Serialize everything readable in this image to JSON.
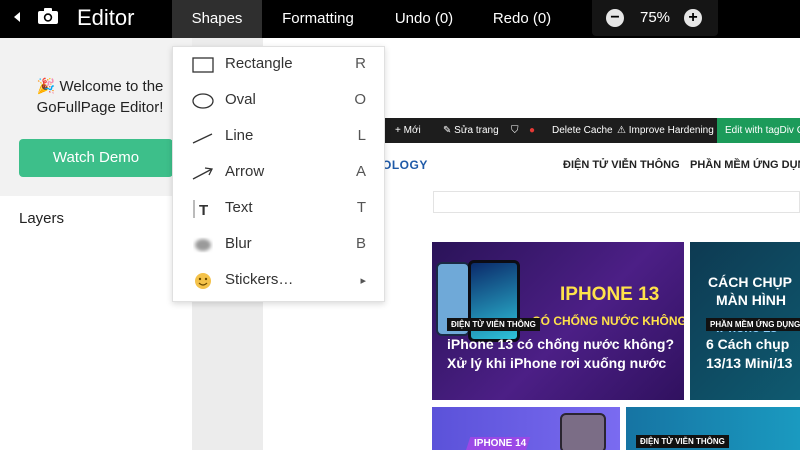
{
  "app": {
    "title": "Editor",
    "back_icon": "chevron-left-icon",
    "camera_icon": "camera-icon"
  },
  "menus": {
    "shapes": "Shapes",
    "formatting": "Formatting",
    "undo": "Undo (0)",
    "redo": "Redo (0)"
  },
  "zoom": {
    "minus": "−",
    "value": "75%",
    "plus": "+"
  },
  "left_panel": {
    "welcome_emoji": "🎉",
    "welcome_text": "Welcome to the GoFullPage Editor!",
    "watch_demo": "Watch Demo",
    "layers": "Layers",
    "accent_color": "#3dbf8a"
  },
  "shapes_menu": {
    "items": [
      {
        "label": "Rectangle",
        "key": "R",
        "icon": "rectangle-icon"
      },
      {
        "label": "Oval",
        "key": "O",
        "icon": "oval-icon"
      },
      {
        "label": "Line",
        "key": "L",
        "icon": "line-icon"
      },
      {
        "label": "Arrow",
        "key": "A",
        "icon": "arrow-icon"
      },
      {
        "label": "Text",
        "key": "T",
        "icon": "text-icon"
      },
      {
        "label": "Blur",
        "key": "B",
        "icon": "blur-icon"
      },
      {
        "label": "Stickers…",
        "key": "▸",
        "icon": "smiley-icon"
      }
    ]
  },
  "webpage": {
    "admin_bar": {
      "new": "+ Mới",
      "edit": "✎ Sửa trang",
      "delete_cache": "Delete Cache",
      "improve": "⚠ Improve Hardening",
      "tagdiv": "Edit with tagDiv Co"
    },
    "logo_text": "OLOGY",
    "nav": [
      "ĐIỆN TỬ VIỄN THÔNG",
      "PHẦN MỀM ỨNG DỤNG"
    ],
    "cards": [
      {
        "image_title_1": "IPHONE 13",
        "image_title_2": "CÓ CHỐNG NƯỚC KHÔNG",
        "category": "ĐIỆN TỬ VIỄN THÔNG",
        "headline_1": "iPhone 13 có chống nước không?",
        "headline_2": "Xử lý khi iPhone rơi xuống nước"
      },
      {
        "image_title_1": "CÁCH CHỤP",
        "image_title_2": "MÀN HÌNH",
        "image_title_3": "iPhone 13",
        "category": "PHẦN MỀM ỨNG DỤNG",
        "headline_1": "6 Cách chụp",
        "headline_2": "13/13 Mini/13"
      },
      {
        "image_title_1": "IPHONE 14"
      },
      {
        "category": "ĐIỆN TỬ VIỄN THÔNG"
      }
    ]
  }
}
